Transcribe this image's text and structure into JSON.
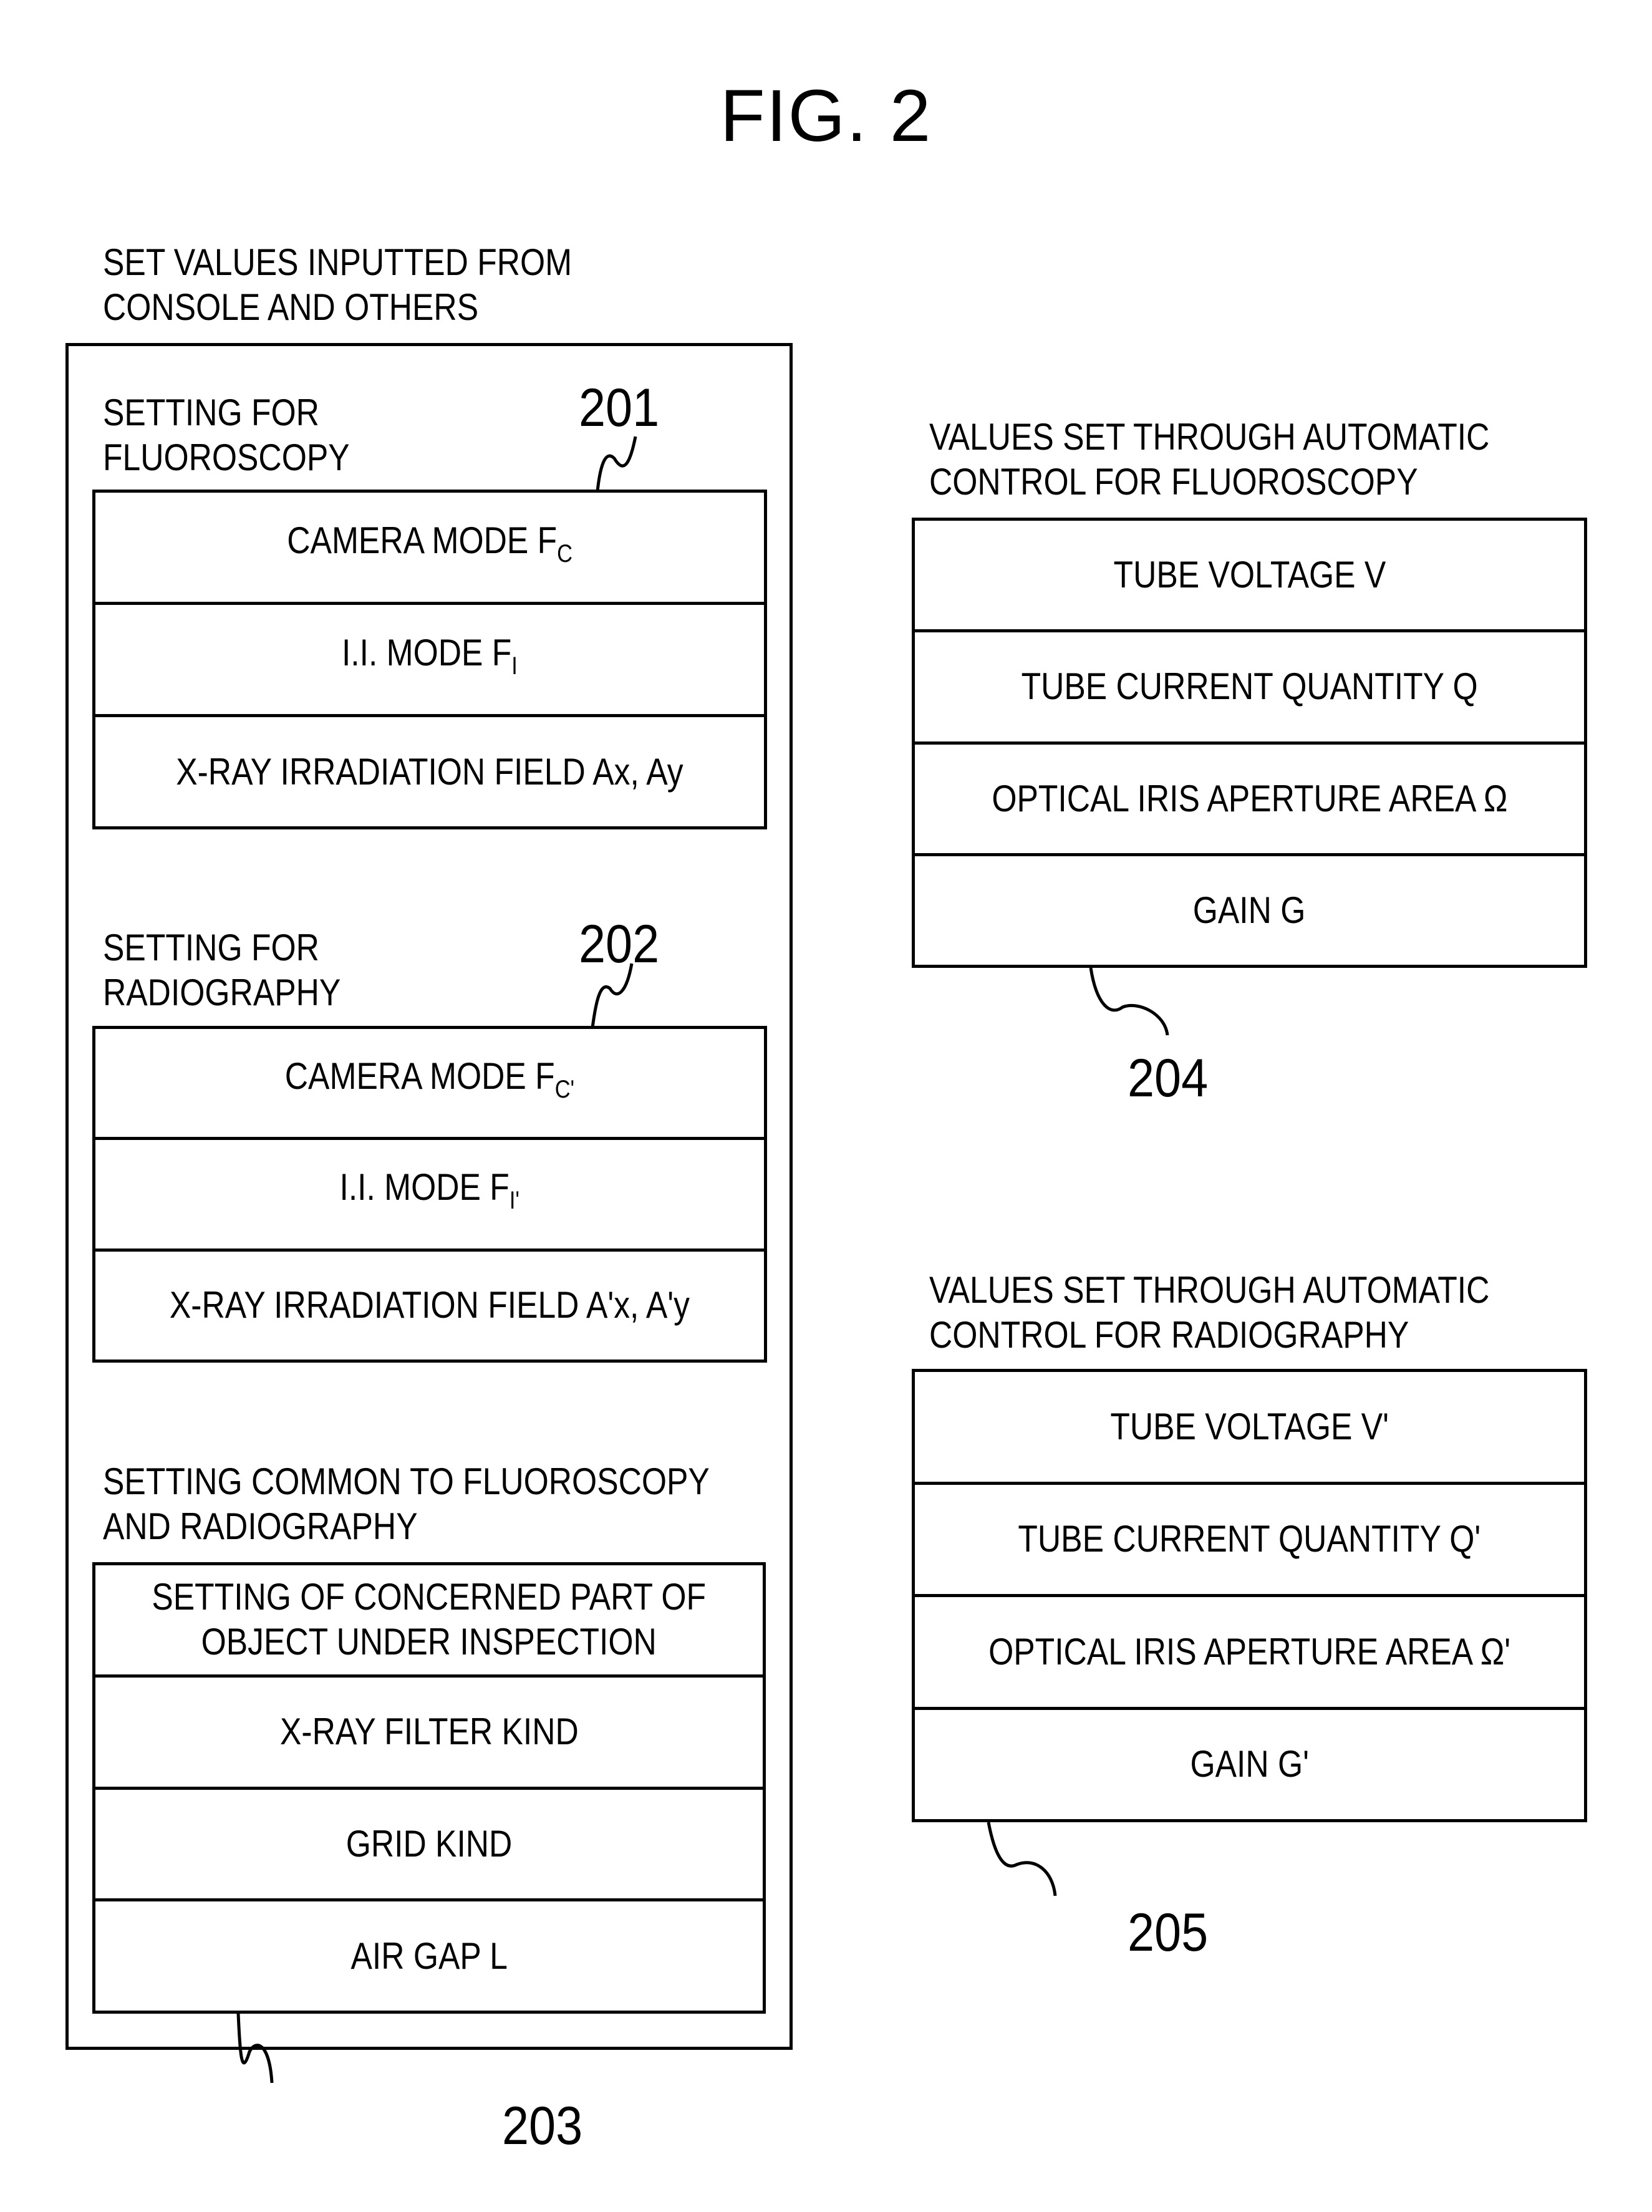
{
  "figure": {
    "title": "FIG. 2"
  },
  "left_panel": {
    "heading": [
      "SET VALUES INPUTTED FROM",
      "CONSOLE AND OTHERS"
    ],
    "fluoroscopy": {
      "heading": [
        "SETTING FOR",
        "FLUOROSCOPY"
      ],
      "ref": "201",
      "rows": [
        {
          "text": "CAMERA MODE F",
          "sub": "C"
        },
        {
          "text": "I.I. MODE F",
          "sub": "I"
        },
        {
          "text": "X-RAY IRRADIATION FIELD Ax, Ay",
          "sub": ""
        }
      ]
    },
    "radiography": {
      "heading": [
        "SETTING FOR",
        "RADIOGRAPHY"
      ],
      "ref": "202",
      "rows": [
        {
          "text": "CAMERA MODE F",
          "sub": "C'"
        },
        {
          "text": "I.I. MODE F",
          "sub": "I'"
        },
        {
          "text": "X-RAY IRRADIATION FIELD A'x, A'y",
          "sub": ""
        }
      ]
    },
    "common": {
      "heading": [
        "SETTING COMMON TO FLUOROSCOPY",
        "AND RADIOGRAPHY"
      ],
      "ref": "203",
      "rows": [
        {
          "text": "SETTING OF CONCERNED PART OF\nOBJECT UNDER INSPECTION",
          "sub": ""
        },
        {
          "text": "X-RAY FILTER KIND",
          "sub": ""
        },
        {
          "text": "GRID KIND",
          "sub": ""
        },
        {
          "text": "AIR GAP L",
          "sub": ""
        }
      ]
    }
  },
  "right_panel": {
    "fluoroscopy_auto": {
      "heading": [
        "VALUES SET THROUGH AUTOMATIC",
        "CONTROL FOR FLUOROSCOPY"
      ],
      "ref": "204",
      "rows": [
        {
          "text": "TUBE VOLTAGE V",
          "sub": ""
        },
        {
          "text": "TUBE CURRENT QUANTITY Q",
          "sub": ""
        },
        {
          "text": "OPTICAL IRIS APERTURE AREA Ω",
          "sub": ""
        },
        {
          "text": "GAIN G",
          "sub": ""
        }
      ]
    },
    "radiography_auto": {
      "heading": [
        "VALUES SET THROUGH AUTOMATIC",
        "CONTROL FOR RADIOGRAPHY"
      ],
      "ref": "205",
      "rows": [
        {
          "text": "TUBE VOLTAGE V'",
          "sub": ""
        },
        {
          "text": "TUBE CURRENT QUANTITY Q'",
          "sub": ""
        },
        {
          "text": "OPTICAL IRIS APERTURE AREA Ω'",
          "sub": ""
        },
        {
          "text": "GAIN G'",
          "sub": ""
        }
      ]
    }
  }
}
